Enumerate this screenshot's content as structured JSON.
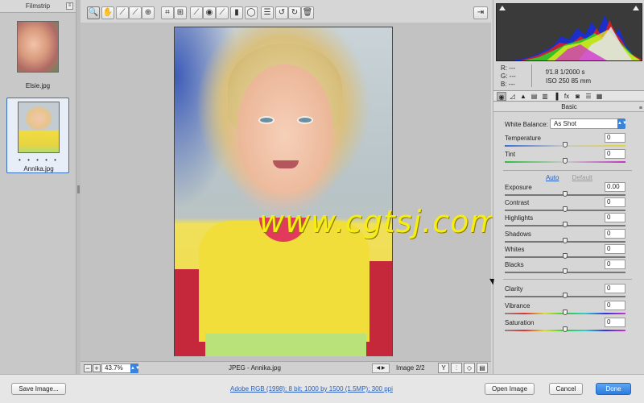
{
  "filmstrip": {
    "title": "Filmstrip",
    "menu_glyph": "≡",
    "items": [
      {
        "label": "Elsie.jpg"
      },
      {
        "label": "Annika.jpg",
        "selected": true,
        "dots": "• • • • •"
      }
    ]
  },
  "toolbar": {
    "tools": [
      {
        "icon": "zoom-icon",
        "glyph": "🔍"
      },
      {
        "icon": "hand-icon",
        "glyph": "✋"
      },
      {
        "icon": "white-balance-icon",
        "glyph": "⟋"
      },
      {
        "icon": "color-sampler-icon",
        "glyph": "⟋"
      },
      {
        "icon": "target-adjust-icon",
        "glyph": "⊕"
      },
      {
        "icon": "crop-icon",
        "glyph": "⌗"
      },
      {
        "icon": "straighten-icon",
        "glyph": "⊞"
      },
      {
        "icon": "spot-removal-icon",
        "glyph": "⟋"
      },
      {
        "icon": "red-eye-icon",
        "glyph": "◉"
      },
      {
        "icon": "adjustment-brush-icon",
        "glyph": "⟋"
      },
      {
        "icon": "graduated-filter-icon",
        "glyph": "▮"
      },
      {
        "icon": "radial-filter-icon",
        "glyph": "◯"
      },
      {
        "icon": "preferences-icon",
        "glyph": "☰"
      },
      {
        "icon": "rotate-left-icon",
        "glyph": "↺"
      },
      {
        "icon": "rotate-right-icon",
        "glyph": "↻"
      },
      {
        "icon": "trash-icon",
        "glyph": "🗑"
      }
    ],
    "fullscreen_glyph": "⇥"
  },
  "canvas": {
    "watermark": "www.cgtsj.com"
  },
  "statusbar": {
    "zoom_out_glyph": "−",
    "zoom_in_glyph": "+",
    "zoom_value": "43.7%",
    "file_info": "JPEG  -  Annika.jpg",
    "nav_glyph": "◀  ▶",
    "image_count": "Image 2/2",
    "view_glyphs": [
      "Y",
      "⫶",
      "◇",
      "▤"
    ]
  },
  "histogram": {
    "readout": {
      "r": "R:   ---",
      "g": "G:   ---",
      "b": "B:   ---"
    },
    "exif_line1": "f/1.8     1/2000 s",
    "exif_line2": "ISO 250     85 mm"
  },
  "panel_tabs": [
    "◉",
    "◿",
    "▲",
    "▤",
    "▥",
    "▐",
    "fx",
    "◙",
    "☰",
    "▦"
  ],
  "basic": {
    "title": "Basic",
    "menu_glyph": "≡",
    "white_balance_label": "White Balance:",
    "white_balance_value": "As Shot",
    "auto_label": "Auto",
    "default_label": "Default",
    "sliders": [
      {
        "label": "Temperature",
        "value": "0",
        "level": 0.5
      },
      {
        "label": "Tint",
        "value": "0",
        "level": 0.5
      },
      {
        "label": "Exposure",
        "value": "0.00",
        "level": 0.5
      },
      {
        "label": "Contrast",
        "value": "0",
        "level": 0.5
      },
      {
        "label": "Highlights",
        "value": "0",
        "level": 0.5
      },
      {
        "label": "Shadows",
        "value": "0",
        "level": 0.5
      },
      {
        "label": "Whites",
        "value": "0",
        "level": 0.5
      },
      {
        "label": "Blacks",
        "value": "0",
        "level": 0.5
      },
      {
        "label": "Clarity",
        "value": "0",
        "level": 0.5
      },
      {
        "label": "Vibrance",
        "value": "0",
        "level": 0.5
      },
      {
        "label": "Saturation",
        "value": "0",
        "level": 0.5
      }
    ]
  },
  "footer": {
    "save_label": "Save Image...",
    "link": "Adobe RGB (1998); 8 bit; 1000 by 1500 (1.5MP); 300 ppi",
    "open_label": "Open Image",
    "cancel_label": "Cancel",
    "done_label": "Done"
  },
  "colors": {
    "accent": "#2c7ce0",
    "watermark": "#f6ee10"
  }
}
